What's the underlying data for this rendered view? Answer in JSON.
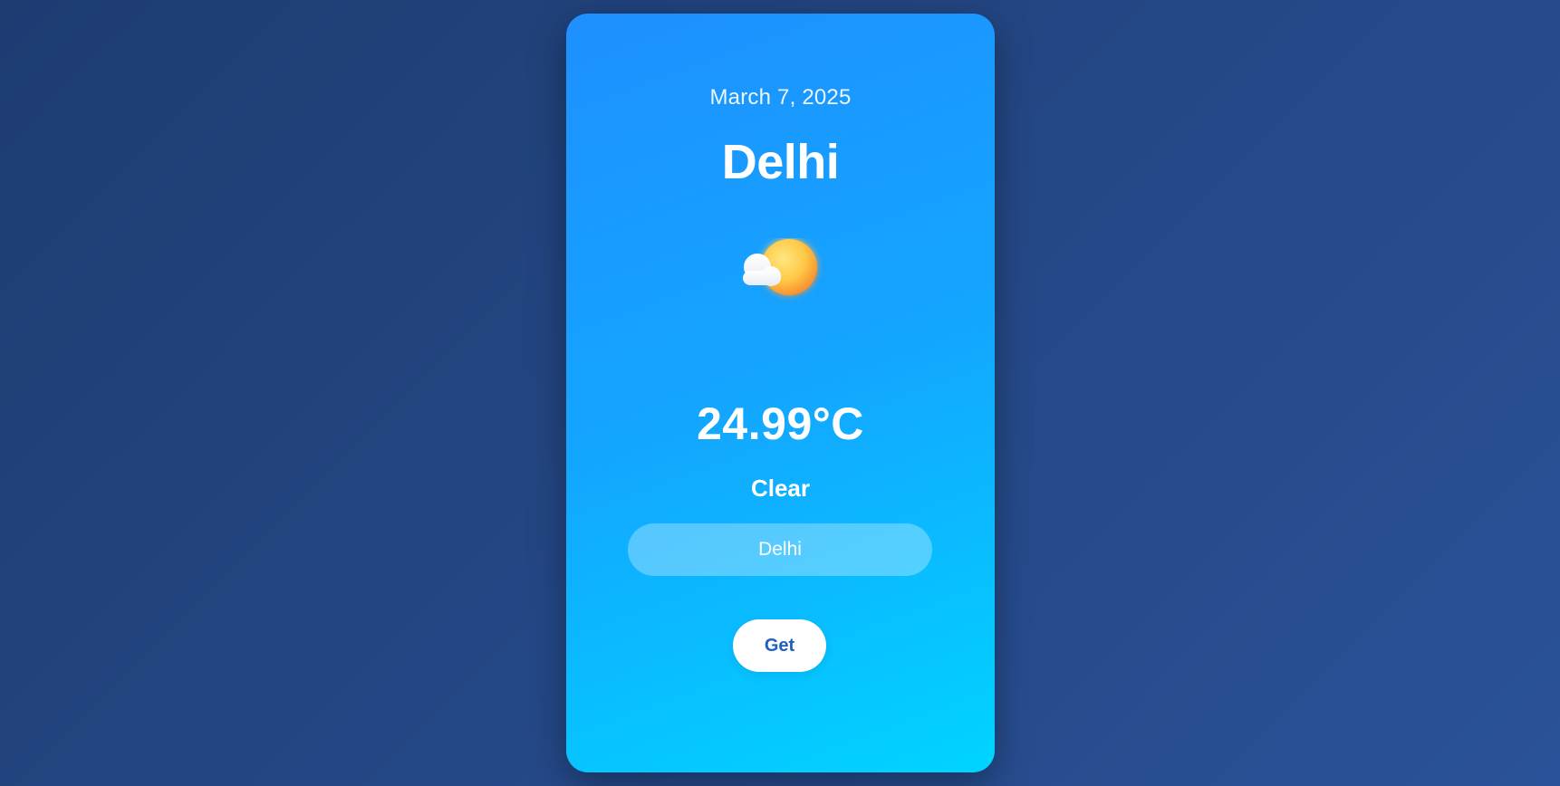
{
  "weather": {
    "date": "March 7, 2025",
    "city": "Delhi",
    "icon": "partly-cloudy-icon",
    "temperature": "24.99°C",
    "condition": "Clear"
  },
  "search": {
    "value": "Delhi",
    "placeholder": ""
  },
  "actions": {
    "get_label": "Get"
  },
  "colors": {
    "background_start": "#1e3c72",
    "background_end": "#2a5298",
    "card_start": "#1e90ff",
    "card_end": "#00d4ff",
    "button_text": "#1e5fc0"
  }
}
